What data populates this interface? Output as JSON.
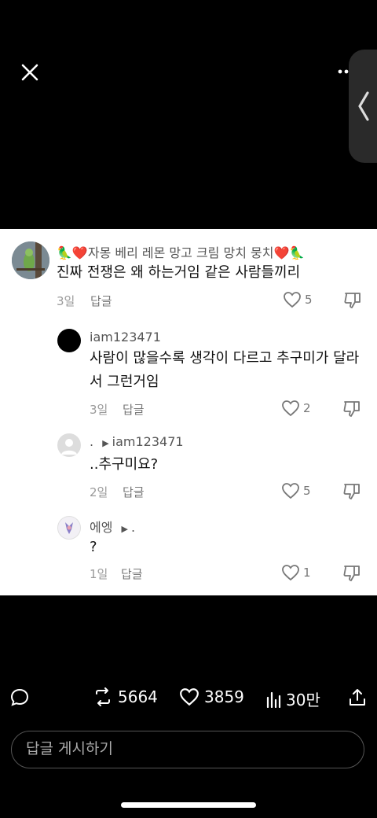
{
  "icons": {
    "close": "close-icon",
    "more": "more-dots-icon",
    "side_handle": "chevron-left-icon",
    "like": "heart-icon",
    "dislike": "thumbs-down-icon",
    "comment": "speech-bubble-icon",
    "repost": "repost-icon",
    "bookmark_like": "heart-outline-icon",
    "views": "bar-chart-icon",
    "share": "share-icon"
  },
  "comments": [
    {
      "author": "🦜❤️자몽 베리 레몬 망고 크림 망치 뭉치❤️🦜",
      "text": "진짜 전쟁은 왜 하는거임 같은 사람들끼리",
      "time": "3일",
      "reply_label": "답글",
      "likes": "5"
    },
    {
      "author": "iam123471",
      "text": "사람이 많을수록 생각이 다르고 추구미가 달라서 그런거임",
      "time": "3일",
      "reply_label": "답글",
      "likes": "2"
    },
    {
      "author": ".",
      "reply_to": "iam123471",
      "text": "..추구미요?",
      "time": "2일",
      "reply_label": "답글",
      "likes": "5"
    },
    {
      "author": "에엥",
      "reply_to": ".",
      "text": "?",
      "time": "1일",
      "reply_label": "답글",
      "likes": "1"
    }
  ],
  "actions": {
    "reposts": "5664",
    "likes": "3859",
    "views": "30만"
  },
  "reply_input": {
    "placeholder": "답글 게시하기"
  },
  "colors": {
    "background": "#000000",
    "card": "#ffffff",
    "muted": "#999999"
  }
}
